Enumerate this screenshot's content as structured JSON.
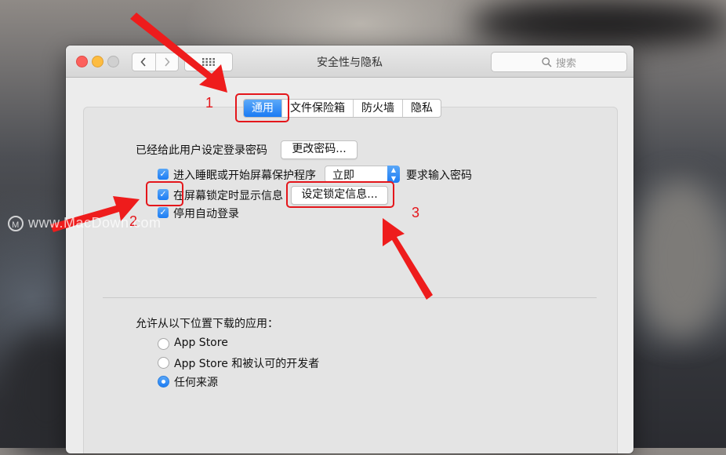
{
  "window": {
    "title": "安全性与隐私",
    "search_placeholder": "搜索"
  },
  "tabs": [
    {
      "label": "通用",
      "active": true
    },
    {
      "label": "文件保险箱",
      "active": false
    },
    {
      "label": "防火墙",
      "active": false
    },
    {
      "label": "隐私",
      "active": false
    }
  ],
  "general": {
    "password_label": "已经给此用户设定登录密码",
    "change_password_button": "更改密码...",
    "sleep_option": {
      "label": "进入睡眠或开始屏幕保护程序",
      "checked": true
    },
    "sleep_select_value": "立即",
    "require_password_label": "要求输入密码",
    "show_message_option": {
      "label": "在屏幕锁定时显示信息",
      "checked": true
    },
    "set_lock_message_button": "设定锁定信息...",
    "disable_autologin_option": {
      "label": "停用自动登录",
      "checked": true
    }
  },
  "downloads": {
    "heading": "允许从以下位置下载的应用：",
    "options": [
      {
        "label": "App Store",
        "selected": false
      },
      {
        "label": "App Store 和被认可的开发者",
        "selected": false
      },
      {
        "label": "任何来源",
        "selected": true
      }
    ]
  },
  "annotations": {
    "step1": "1",
    "step2": "2",
    "step3": "3",
    "color": "#e4161b"
  },
  "watermark": {
    "logo": "M",
    "text": "www.MacDown.com"
  },
  "colors": {
    "accent": "#1c7cf4",
    "close": "#fc605c",
    "minimize": "#fdbc40"
  }
}
